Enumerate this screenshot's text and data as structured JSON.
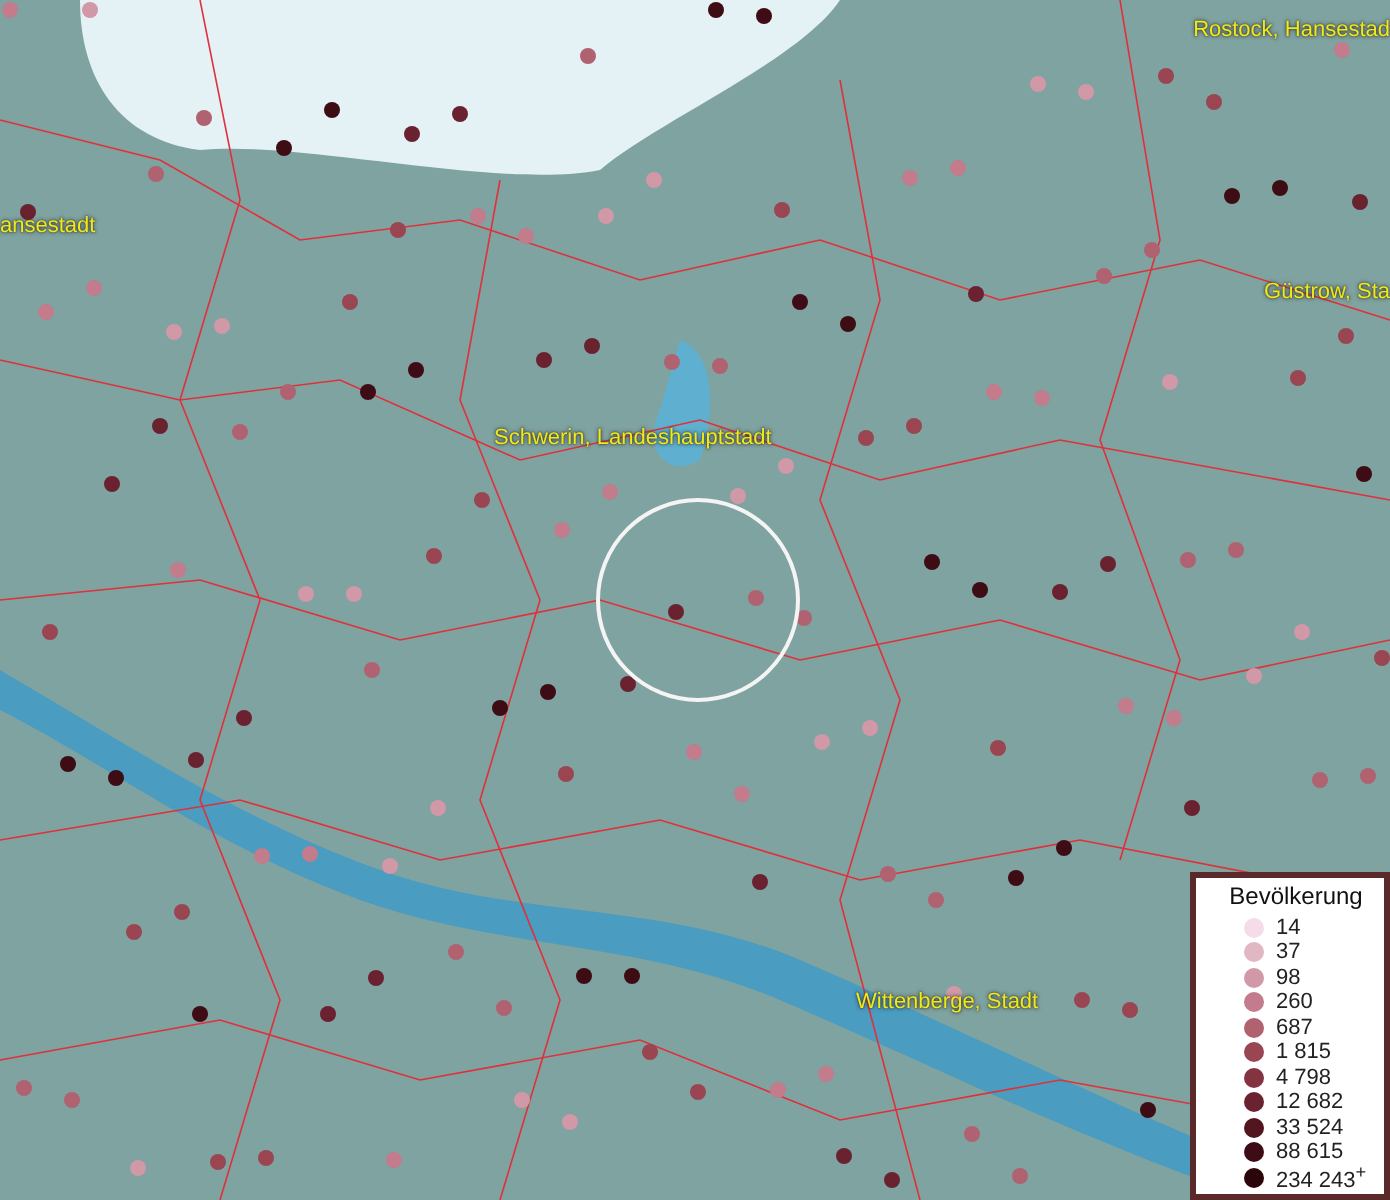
{
  "map": {
    "places": [
      {
        "name": "Rostock, Hansestad"
      },
      {
        "name": "ansestadt"
      },
      {
        "name": "Güstrow, Sta"
      },
      {
        "name": "Schwerin, Landeshauptstadt"
      },
      {
        "name": "Wittenberge, Stadt"
      }
    ]
  },
  "legend": {
    "title": "Bevölkerung",
    "items": [
      {
        "label": "14",
        "color": "#f5dce8"
      },
      {
        "label": "37",
        "color": "#e2b7c4"
      },
      {
        "label": "98",
        "color": "#d198a8"
      },
      {
        "label": "260",
        "color": "#c27c8c"
      },
      {
        "label": "687",
        "color": "#b06270"
      },
      {
        "label": "1 815",
        "color": "#9a4552"
      },
      {
        "label": "4 798",
        "color": "#833440"
      },
      {
        "label": "12 682",
        "color": "#6b2230"
      },
      {
        "label": "33 524",
        "color": "#521520"
      },
      {
        "label": "88 615",
        "color": "#3e0c14"
      },
      {
        "label": "234 243$^{+}$",
        "color": "#2a060a"
      }
    ]
  }
}
